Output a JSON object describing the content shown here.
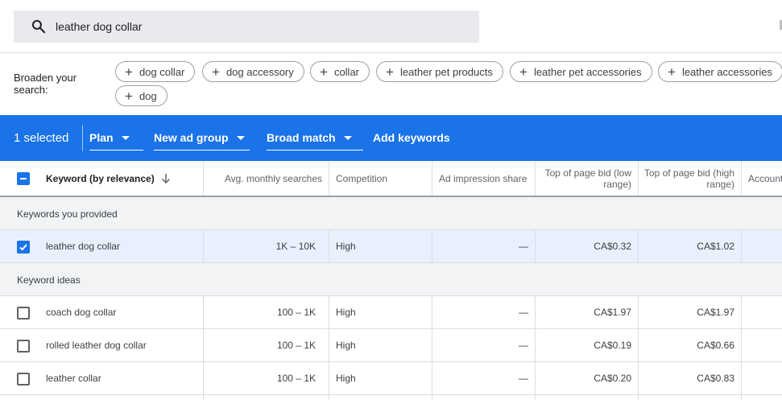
{
  "search": {
    "query": "leather dog collar"
  },
  "broaden": {
    "label": "Broaden your search:",
    "chips": [
      "dog collar",
      "dog accessory",
      "collar",
      "leather pet products",
      "leather pet accessories",
      "leather accessories",
      "dog"
    ]
  },
  "actionbar": {
    "selected": "1 selected",
    "plan": "Plan",
    "new_ad_group": "New ad group",
    "match": "Broad match",
    "add_keywords": "Add keywords"
  },
  "columns": {
    "keyword": "Keyword (by relevance)",
    "searches": "Avg. monthly searches",
    "competition": "Competition",
    "impression": "Ad impression share",
    "bid_low": "Top of page bid (low range)",
    "bid_high": "Top of page bid (high range)",
    "account": "Account"
  },
  "sections": {
    "provided": "Keywords you provided",
    "ideas": "Keyword ideas"
  },
  "provided_rows": [
    {
      "keyword": "leather dog collar",
      "searches": "1K – 10K",
      "competition": "High",
      "impression": "—",
      "bid_low": "CA$0.32",
      "bid_high": "CA$1.02",
      "checked": true
    }
  ],
  "idea_rows": [
    {
      "keyword": "coach dog collar",
      "searches": "100 – 1K",
      "competition": "High",
      "impression": "—",
      "bid_low": "CA$1.97",
      "bid_high": "CA$1.97",
      "checked": false
    },
    {
      "keyword": "rolled leather dog collar",
      "searches": "100 – 1K",
      "competition": "High",
      "impression": "—",
      "bid_low": "CA$0.19",
      "bid_high": "CA$0.66",
      "checked": false
    },
    {
      "keyword": "leather collar",
      "searches": "100 – 1K",
      "competition": "High",
      "impression": "—",
      "bid_low": "CA$0.20",
      "bid_high": "CA$0.83",
      "checked": false
    }
  ],
  "colors": {
    "accent": "#1a73e8",
    "selected_row": "#e8f0fe",
    "section_bg": "#f1f3f4"
  },
  "icons": {
    "search": "search-icon",
    "sort": "arrow-down-icon"
  }
}
